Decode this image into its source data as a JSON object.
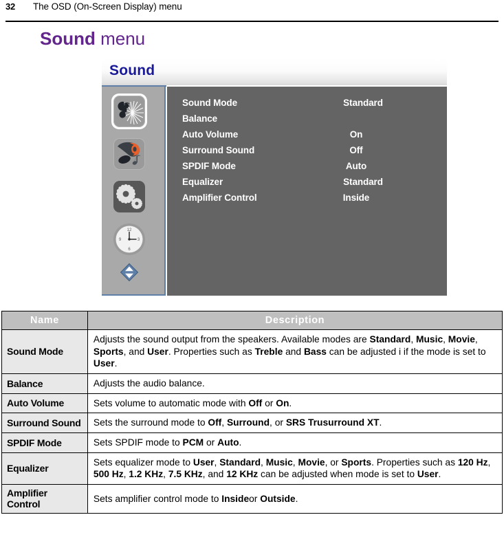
{
  "page": {
    "number": "32",
    "running_header": "The OSD (On-Screen Display) menu",
    "section_title_bold": "Sound",
    "section_title_light": " menu"
  },
  "osd": {
    "title": "Sound",
    "sidebar_icons": [
      {
        "name": "picture-butterfly-icon",
        "selected": true
      },
      {
        "name": "sound-headphones-icon",
        "selected": false
      },
      {
        "name": "settings-gears-icon",
        "selected": false
      },
      {
        "name": "timer-clock-icon",
        "selected": false
      },
      {
        "name": "nav-up-down-icon",
        "selected": false
      }
    ],
    "rows": [
      {
        "label": "Sound Mode",
        "value": "Standard"
      },
      {
        "label": "Balance",
        "value": ""
      },
      {
        "label": "Auto Volume",
        "value": "On"
      },
      {
        "label": "Surround Sound",
        "value": "Off"
      },
      {
        "label": "SPDIF Mode",
        "value": "Auto"
      },
      {
        "label": "Equalizer",
        "value": "Standard"
      },
      {
        "label": "Amplifier Control",
        "value": "Inside"
      }
    ]
  },
  "table": {
    "headers": {
      "name": "Name",
      "description": "Description"
    },
    "rows": [
      {
        "name": "Sound Mode",
        "description_html": "Adjusts the sound output from the speakers. Available modes are <b>Standard</b>, <b>Music</b>, <b>Movie</b>, <b>Sports</b>, and <b>User</b>. Properties such as <b>Treble</b> and <b>Bass</b> can be adjusted i if the mode is set to <b>User</b>."
      },
      {
        "name": "Balance",
        "description_html": "Adjusts the audio balance."
      },
      {
        "name": "Auto Volume",
        "description_html": "Sets volume to automatic mode with <b>Off</b> or <b>On</b>."
      },
      {
        "name": "Surround Sound",
        "description_html": "Sets the surround mode to <b>Off</b>, <b>Surround</b>, or <b>SRS Trusurround XT</b>."
      },
      {
        "name": "SPDIF Mode",
        "description_html": "Sets SPDIF mode to <b>PCM</b> or <b>Auto</b>."
      },
      {
        "name": "Equalizer",
        "description_html": "Sets equalizer mode to <b>User</b>, <b>Standard</b>, <b>Music</b>, <b>Movie</b>, or <b>Sports</b>. Properties such as <b>120 Hz</b>, <b>500 Hz</b>, <b>1.2 KHz</b>, <b>7.5 KHz</b>, and <b>12 KHz</b> can be adjusted when mode is set to <b>User</b>."
      },
      {
        "name": "Amplifier Control",
        "description_html": "Sets amplifier control mode to <b>Inside</b>or <b>Outside</b>."
      }
    ]
  },
  "colors": {
    "section_title": "#62258c",
    "osd_title": "#1a1a99",
    "osd_sidebar": "#a9a9a9",
    "osd_content": "#646464",
    "osd_accent_line": "#5d7fa8",
    "table_header": "#bfbfbf",
    "table_name_cell": "#e8e8e8"
  }
}
